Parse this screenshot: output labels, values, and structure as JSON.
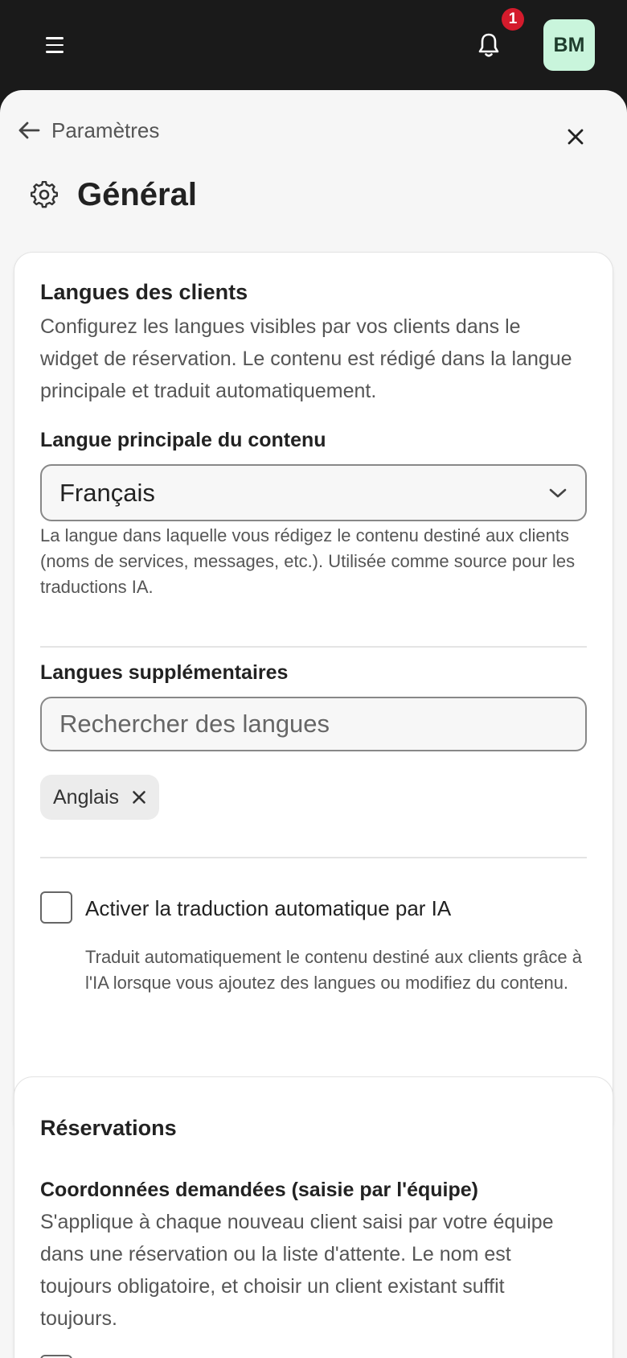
{
  "topbar": {
    "notification_count": "1",
    "avatar_initials": "BM",
    "avatar_bg": "#c9f5dc",
    "badge_color": "#d41b2c",
    "icons": [
      "menu-icon",
      "bell-icon"
    ]
  },
  "nav": {
    "back_label": "Paramètres",
    "back_icon": "arrow-left-icon",
    "close_icon": "close-icon"
  },
  "page": {
    "title": "Général",
    "icon": "gear-icon"
  },
  "languages": {
    "heading": "Langues des clients",
    "description": "Configurez les langues visibles par vos clients dans le widget de réservation. Le contenu est rédigé dans la langue principale et traduit automatiquement.",
    "primary_label": "Langue principale du contenu",
    "primary_value": "Français",
    "primary_help": "La langue dans laquelle vous rédigez le contenu destiné aux clients (noms de services, messages, etc.). Utilisée comme source pour les traductions IA.",
    "additional_label": "Langues supplémentaires",
    "search_placeholder": "Rechercher des langues",
    "selected_chips": [
      {
        "label": "Anglais"
      }
    ],
    "ai_checkbox_label": "Activer la traduction automatique par IA",
    "ai_checkbox_checked": false,
    "ai_help": "Traduit automatiquement le contenu destiné aux clients grâce à l'IA lorsque vous ajoutez des langues ou modifiez du contenu."
  },
  "reservations": {
    "heading": "Réservations",
    "contact_label": "Coordonnées demandées (saisie par l'équipe)",
    "contact_description": "S'applique à chaque nouveau client saisi par votre équipe dans une réservation ou la liste d'attente. Le nom est toujours obligatoire, et choisir un client existant suffit toujours."
  }
}
